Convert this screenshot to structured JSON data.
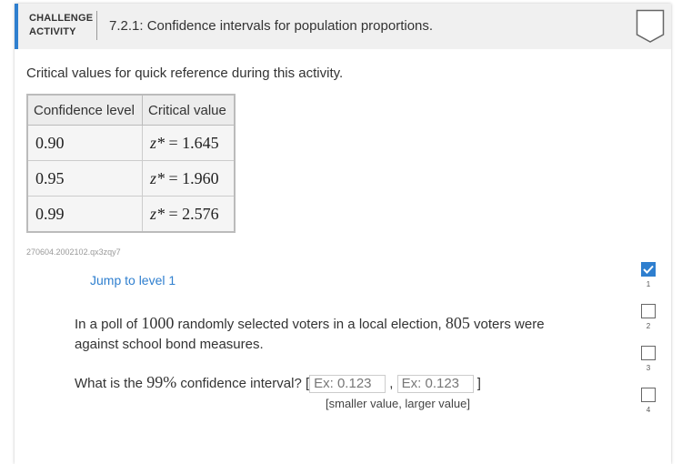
{
  "header": {
    "type_label_line1": "CHALLENGE",
    "type_label_line2": "ACTIVITY",
    "title": "7.2.1: Confidence intervals for population proportions."
  },
  "intro": "Critical values for quick reference during this activity.",
  "table": {
    "headers": [
      "Confidence level",
      "Critical value"
    ],
    "rows": [
      {
        "level": "0.90",
        "var": "z*",
        "eq": " = 1.645"
      },
      {
        "level": "0.95",
        "var": "z*",
        "eq": " = 1.960"
      },
      {
        "level": "0.99",
        "var": "z*",
        "eq": " = 2.576"
      }
    ]
  },
  "identifier": "270604.2002102.qx3zqy7",
  "jump_label": "Jump to level 1",
  "question": {
    "p1": "In a poll of ",
    "n1": "1000",
    "p2": " randomly selected voters in a local election, ",
    "n2": "805",
    "p3": " voters were against school bond measures.",
    "ask_prefix": "What is the ",
    "ask_num": "99%",
    "ask_suffix": " confidence interval? [",
    "input1_placeholder": "Ex: 0.123",
    "comma": " , ",
    "input2_placeholder": "Ex: 0.123",
    "close": " ]",
    "hint": "[smaller value, larger value]"
  },
  "levels": [
    {
      "n": "1",
      "done": true
    },
    {
      "n": "2",
      "done": false
    },
    {
      "n": "3",
      "done": false
    },
    {
      "n": "4",
      "done": false
    }
  ],
  "colors": {
    "accent": "#2f7fcf"
  }
}
